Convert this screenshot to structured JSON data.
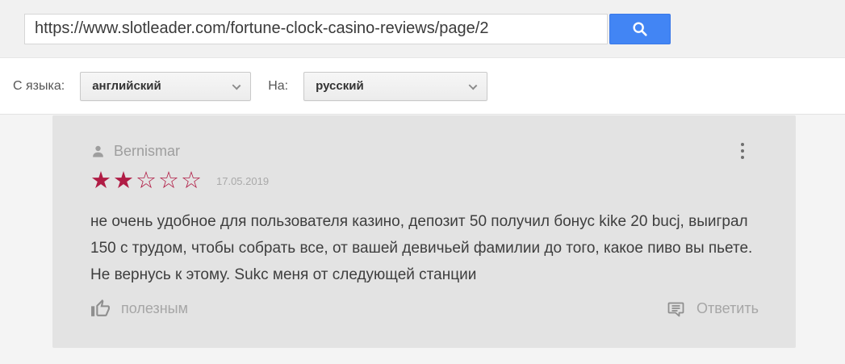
{
  "colors": {
    "accent": "#4285f4",
    "star": "#b01c45",
    "card-bg": "#e3e3e3",
    "page-bg": "#f4f4f4",
    "topbar-bg": "#f1f1f1"
  },
  "url_bar": {
    "value": "https://www.slotleader.com/fortune-clock-casino-reviews/page/2",
    "search_icon": "magnifying-glass"
  },
  "language_bar": {
    "from_label": "С языка:",
    "from_value": "английский",
    "to_label": "На:",
    "to_value": "русский",
    "dropdown_icon": "chevron-down"
  },
  "review": {
    "author": "Bernismar",
    "author_icon": "person-silhouette",
    "date": "17.05.2019",
    "rating": 2,
    "max_rating": 5,
    "text": "не очень удобное для пользователя казино, депозит 50 получил бонус kike 20 bucj, выиграл 150 с трудом, чтобы собрать все, от вашей девичьей фамилии до того, какое пиво вы пьете. Не вернусь к этому. Sukc меня от следующей станции",
    "helpful_label": "полезным",
    "helpful_icon": "thumb-up-outline",
    "reply_label": "Ответить",
    "reply_icon": "comment-bubble",
    "menu_icon": "kebab-vertical-dots"
  }
}
